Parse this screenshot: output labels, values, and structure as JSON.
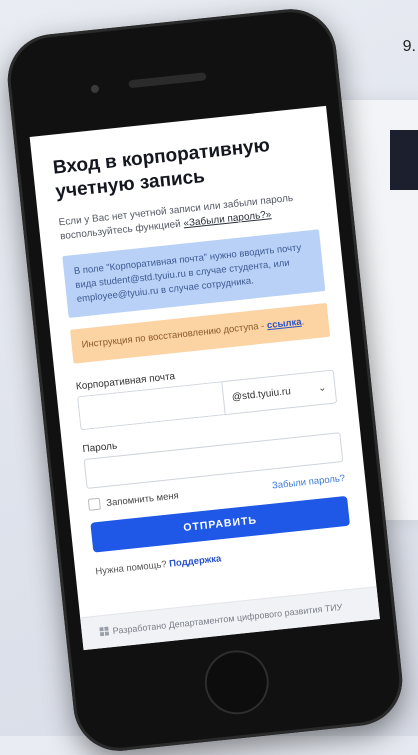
{
  "background": {
    "corner_number": "9.",
    "dark_block_color": "#1b1f2e"
  },
  "login": {
    "title": "Вход в корпоративную учетную запись",
    "subtitle_text": "Если у Вас нет учетной записи или забыли пароль воспользуйтесь функцией ",
    "subtitle_link": "«Забыли пароль?»",
    "info_text": "В поле \"Корпоративная почта\" нужно вводить почту вида student@std.tyuiu.ru в случае студента, или employee@tyuiu.ru в случае сотрудника.",
    "warning_text": "Инструкция по восстановлению доступа - ",
    "warning_link": "ссылка",
    "warning_suffix": ".",
    "email_label": "Корпоративная почта",
    "email_value": "",
    "domain_selected": "@std.tyuiu.ru",
    "password_label": "Пароль",
    "password_value": "",
    "remember_label": "Запомнить меня",
    "forgot_link": "Забыли пароль?",
    "submit_label": "ОТПРАВИТЬ",
    "help_text": "Нужна помощь? ",
    "help_link": "Поддержка",
    "footer_text": "Разработано Департаментом цифрового развития ТИУ",
    "colors": {
      "primary": "#1f58e6",
      "info_bg": "#b9d1f7",
      "warning_bg": "#fcd3a3",
      "link": "#2b53c9"
    }
  }
}
